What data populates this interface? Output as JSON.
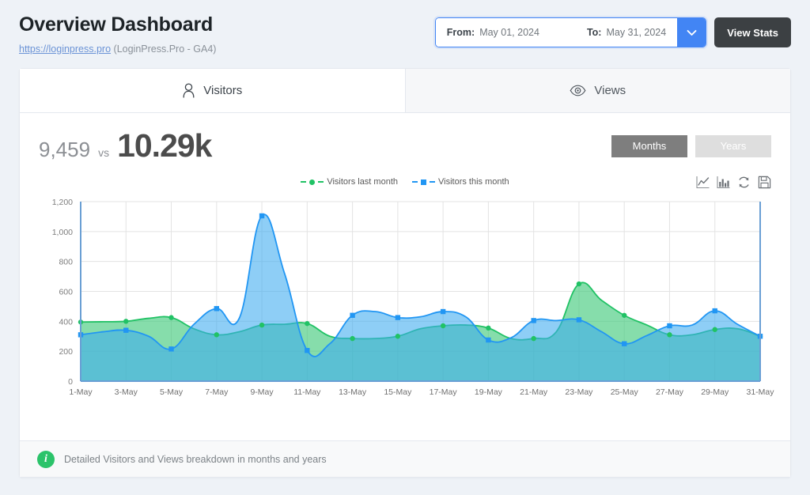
{
  "header": {
    "title": "Overview Dashboard",
    "site_url": "https://loginpress.pro",
    "site_meta": "(LoginPress.Pro - GA4)"
  },
  "daterange": {
    "from_label": "From:",
    "from_value": "May 01, 2024",
    "to_label": "To:",
    "to_value": "May 31, 2024",
    "caret_icon": "chevron-down-icon",
    "view_stats_label": "View Stats"
  },
  "tabs": [
    {
      "label": "Visitors",
      "icon": "user-icon",
      "active": true
    },
    {
      "label": "Views",
      "icon": "eye-icon",
      "active": false
    }
  ],
  "stats": {
    "previous": "9,459",
    "vs": "vs",
    "current": "10.29k"
  },
  "range_buttons": [
    {
      "label": "Months",
      "active": true
    },
    {
      "label": "Years",
      "active": false
    }
  ],
  "chart_tools": [
    {
      "icon": "line-chart-icon",
      "title": "Line chart"
    },
    {
      "icon": "bar-chart-icon",
      "title": "Bar chart"
    },
    {
      "icon": "refresh-icon",
      "title": "Reload"
    },
    {
      "icon": "save-icon",
      "title": "Save"
    }
  ],
  "footer": {
    "info_icon": "info-icon",
    "text": "Detailed Visitors and Views breakdown in months and years"
  },
  "colors": {
    "background": "#eef2f7",
    "card": "#ffffff",
    "accent_blue": "#4285f4",
    "dark_button": "#3c4043",
    "series_last_month": "#21c265",
    "series_this_month": "#2196f3",
    "area_last_month": "#64d98a",
    "area_this_month": "#6fc5f5",
    "info_green": "#2bc36a"
  },
  "chart_data": {
    "type": "area",
    "title": "",
    "xlabel": "",
    "ylabel": "",
    "ylim": [
      0,
      1200
    ],
    "yticks": [
      0,
      200,
      400,
      600,
      800,
      1000,
      1200
    ],
    "ytick_labels": [
      "0",
      "200",
      "400",
      "600",
      "800",
      "1,000",
      "1,200"
    ],
    "grid": true,
    "legend_position": "top-center",
    "x": [
      1,
      2,
      3,
      4,
      5,
      6,
      7,
      8,
      9,
      10,
      11,
      12,
      13,
      14,
      15,
      16,
      17,
      18,
      19,
      20,
      21,
      22,
      23,
      24,
      25,
      26,
      27,
      28,
      29,
      30,
      31
    ],
    "categories": [
      "1-May",
      "2-May",
      "3-May",
      "4-May",
      "5-May",
      "6-May",
      "7-May",
      "8-May",
      "9-May",
      "10-May",
      "11-May",
      "12-May",
      "13-May",
      "14-May",
      "15-May",
      "16-May",
      "17-May",
      "18-May",
      "19-May",
      "20-May",
      "21-May",
      "22-May",
      "23-May",
      "24-May",
      "25-May",
      "26-May",
      "27-May",
      "28-May",
      "29-May",
      "30-May",
      "31-May"
    ],
    "xtick_labels": [
      "1-May",
      "3-May",
      "5-May",
      "7-May",
      "9-May",
      "11-May",
      "13-May",
      "15-May",
      "17-May",
      "19-May",
      "21-May",
      "23-May",
      "25-May",
      "27-May",
      "29-May",
      "31-May"
    ],
    "series": [
      {
        "name": "Visitors last month",
        "color": "#21c265",
        "marker": "circle",
        "values": [
          395,
          397,
          400,
          420,
          425,
          350,
          310,
          330,
          375,
          380,
          385,
          300,
          285,
          285,
          300,
          350,
          370,
          375,
          355,
          285,
          285,
          330,
          650,
          540,
          440,
          375,
          310,
          310,
          345,
          350,
          300
        ]
      },
      {
        "name": "Visitors this month",
        "color": "#2196f3",
        "marker": "square",
        "values": [
          310,
          330,
          340,
          300,
          215,
          380,
          485,
          420,
          1105,
          720,
          205,
          250,
          440,
          465,
          425,
          430,
          465,
          430,
          275,
          290,
          405,
          405,
          410,
          330,
          250,
          305,
          370,
          375,
          470,
          380,
          300
        ]
      }
    ]
  }
}
